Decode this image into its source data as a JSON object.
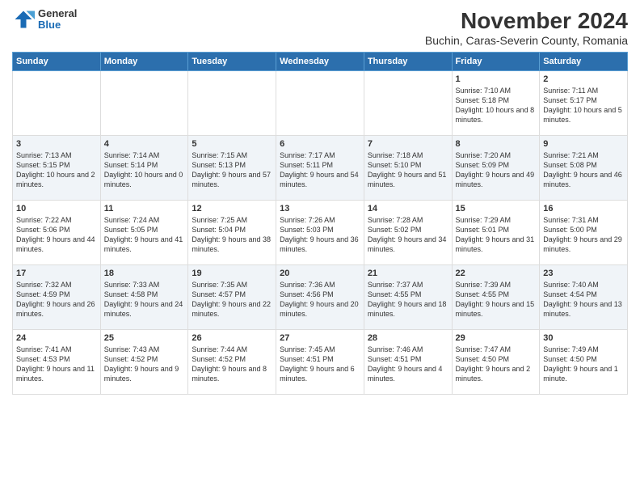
{
  "logo": {
    "general": "General",
    "blue": "Blue"
  },
  "title": "November 2024",
  "subtitle": "Buchin, Caras-Severin County, Romania",
  "days_of_week": [
    "Sunday",
    "Monday",
    "Tuesday",
    "Wednesday",
    "Thursday",
    "Friday",
    "Saturday"
  ],
  "weeks": [
    [
      {
        "day": "",
        "content": ""
      },
      {
        "day": "",
        "content": ""
      },
      {
        "day": "",
        "content": ""
      },
      {
        "day": "",
        "content": ""
      },
      {
        "day": "",
        "content": ""
      },
      {
        "day": "1",
        "content": "Sunrise: 7:10 AM\nSunset: 5:18 PM\nDaylight: 10 hours and 8 minutes."
      },
      {
        "day": "2",
        "content": "Sunrise: 7:11 AM\nSunset: 5:17 PM\nDaylight: 10 hours and 5 minutes."
      }
    ],
    [
      {
        "day": "3",
        "content": "Sunrise: 7:13 AM\nSunset: 5:15 PM\nDaylight: 10 hours and 2 minutes."
      },
      {
        "day": "4",
        "content": "Sunrise: 7:14 AM\nSunset: 5:14 PM\nDaylight: 10 hours and 0 minutes."
      },
      {
        "day": "5",
        "content": "Sunrise: 7:15 AM\nSunset: 5:13 PM\nDaylight: 9 hours and 57 minutes."
      },
      {
        "day": "6",
        "content": "Sunrise: 7:17 AM\nSunset: 5:11 PM\nDaylight: 9 hours and 54 minutes."
      },
      {
        "day": "7",
        "content": "Sunrise: 7:18 AM\nSunset: 5:10 PM\nDaylight: 9 hours and 51 minutes."
      },
      {
        "day": "8",
        "content": "Sunrise: 7:20 AM\nSunset: 5:09 PM\nDaylight: 9 hours and 49 minutes."
      },
      {
        "day": "9",
        "content": "Sunrise: 7:21 AM\nSunset: 5:08 PM\nDaylight: 9 hours and 46 minutes."
      }
    ],
    [
      {
        "day": "10",
        "content": "Sunrise: 7:22 AM\nSunset: 5:06 PM\nDaylight: 9 hours and 44 minutes."
      },
      {
        "day": "11",
        "content": "Sunrise: 7:24 AM\nSunset: 5:05 PM\nDaylight: 9 hours and 41 minutes."
      },
      {
        "day": "12",
        "content": "Sunrise: 7:25 AM\nSunset: 5:04 PM\nDaylight: 9 hours and 38 minutes."
      },
      {
        "day": "13",
        "content": "Sunrise: 7:26 AM\nSunset: 5:03 PM\nDaylight: 9 hours and 36 minutes."
      },
      {
        "day": "14",
        "content": "Sunrise: 7:28 AM\nSunset: 5:02 PM\nDaylight: 9 hours and 34 minutes."
      },
      {
        "day": "15",
        "content": "Sunrise: 7:29 AM\nSunset: 5:01 PM\nDaylight: 9 hours and 31 minutes."
      },
      {
        "day": "16",
        "content": "Sunrise: 7:31 AM\nSunset: 5:00 PM\nDaylight: 9 hours and 29 minutes."
      }
    ],
    [
      {
        "day": "17",
        "content": "Sunrise: 7:32 AM\nSunset: 4:59 PM\nDaylight: 9 hours and 26 minutes."
      },
      {
        "day": "18",
        "content": "Sunrise: 7:33 AM\nSunset: 4:58 PM\nDaylight: 9 hours and 24 minutes."
      },
      {
        "day": "19",
        "content": "Sunrise: 7:35 AM\nSunset: 4:57 PM\nDaylight: 9 hours and 22 minutes."
      },
      {
        "day": "20",
        "content": "Sunrise: 7:36 AM\nSunset: 4:56 PM\nDaylight: 9 hours and 20 minutes."
      },
      {
        "day": "21",
        "content": "Sunrise: 7:37 AM\nSunset: 4:55 PM\nDaylight: 9 hours and 18 minutes."
      },
      {
        "day": "22",
        "content": "Sunrise: 7:39 AM\nSunset: 4:55 PM\nDaylight: 9 hours and 15 minutes."
      },
      {
        "day": "23",
        "content": "Sunrise: 7:40 AM\nSunset: 4:54 PM\nDaylight: 9 hours and 13 minutes."
      }
    ],
    [
      {
        "day": "24",
        "content": "Sunrise: 7:41 AM\nSunset: 4:53 PM\nDaylight: 9 hours and 11 minutes."
      },
      {
        "day": "25",
        "content": "Sunrise: 7:43 AM\nSunset: 4:52 PM\nDaylight: 9 hours and 9 minutes."
      },
      {
        "day": "26",
        "content": "Sunrise: 7:44 AM\nSunset: 4:52 PM\nDaylight: 9 hours and 8 minutes."
      },
      {
        "day": "27",
        "content": "Sunrise: 7:45 AM\nSunset: 4:51 PM\nDaylight: 9 hours and 6 minutes."
      },
      {
        "day": "28",
        "content": "Sunrise: 7:46 AM\nSunset: 4:51 PM\nDaylight: 9 hours and 4 minutes."
      },
      {
        "day": "29",
        "content": "Sunrise: 7:47 AM\nSunset: 4:50 PM\nDaylight: 9 hours and 2 minutes."
      },
      {
        "day": "30",
        "content": "Sunrise: 7:49 AM\nSunset: 4:50 PM\nDaylight: 9 hours and 1 minute."
      }
    ]
  ]
}
